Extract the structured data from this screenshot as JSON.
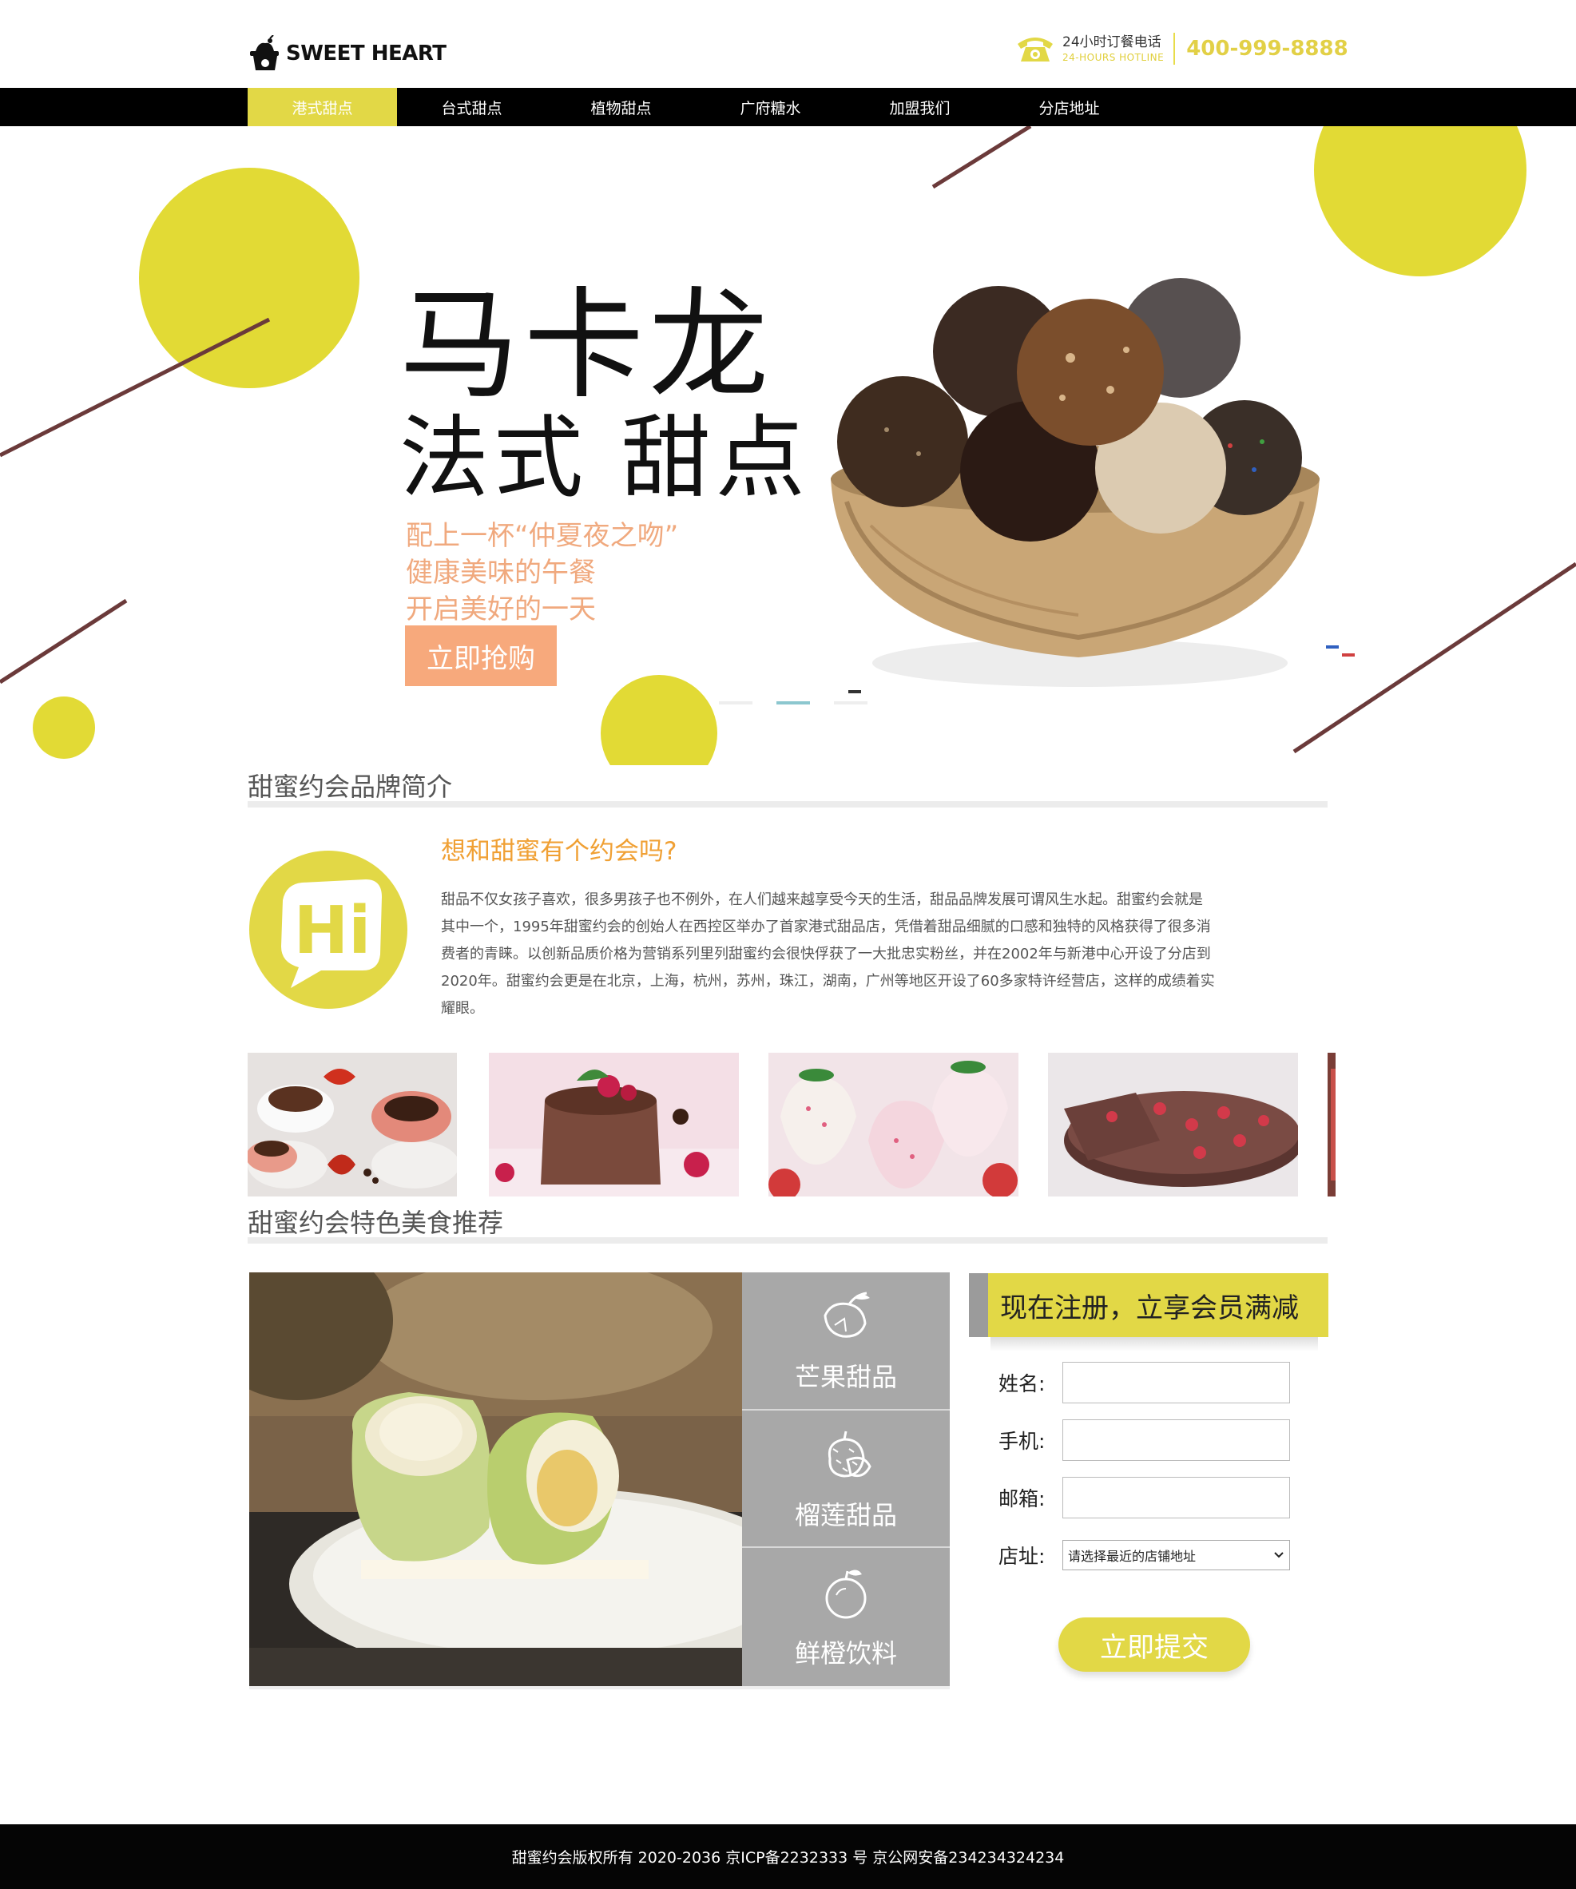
{
  "header": {
    "logo_text": "SWEET HEART",
    "hotline_cn": "24小时订餐电话",
    "hotline_en": "24-HOURS HOTLINE",
    "hotline_number": "400-999-8888"
  },
  "nav": {
    "items": [
      "港式甜点",
      "台式甜点",
      "植物甜点",
      "广府糖水",
      "加盟我们",
      "分店地址"
    ],
    "active_index": 0
  },
  "banner": {
    "title_line1": "马卡龙",
    "title_line2": "法式 甜点",
    "sub_line1": "配上一杯“仲夏夜之吻”",
    "sub_line2": "健康美味的午餐",
    "sub_line3": "开启美好的一天",
    "cta_label": "立即抢购",
    "slide_count": 3,
    "active_slide": 1
  },
  "brand": {
    "title": "甜蜜约会品牌简介",
    "heading": "想和甜蜜有个约会吗?",
    "body": "甜品不仅女孩子喜欢，很多男孩子也不例外，在人们越来越享受今天的生活，甜品品牌发展可谓风生水起。甜蜜约会就是其中一个，1995年甜蜜约会的创始人在西控区举办了首家港式甜品店，凭借着甜品细腻的口感和独特的风格获得了很多消费者的青睐。以创新品质价格为营销系列里列甜蜜约会很快俘获了一大批忠实粉丝，并在2002年与新港中心开设了分店到2020年。甜蜜约会更是在北京，上海，杭州，苏州，珠江，湖南，广州等地区开设了60多家特许经营店，这样的成绩着实耀眼。",
    "badge_text": "Hi"
  },
  "recommend": {
    "title": "甜蜜约会特色美食推荐",
    "categories": [
      "芒果甜品",
      "榴莲甜品",
      "鲜橙饮料"
    ]
  },
  "register": {
    "title": "现在注册，立享会员满减",
    "name_label": "姓名:",
    "phone_label": "手机:",
    "email_label": "邮箱:",
    "store_label": "店址:",
    "store_selected": "请选择最近的店铺地址",
    "submit_label": "立即提交"
  },
  "footer": {
    "text": "甜蜜约会版权所有 2020-2036 京ICP备2232333 号  京公网安备234234324234"
  },
  "colors": {
    "accent_yellow": "#e2d846",
    "accent_orange": "#f7a97c",
    "heading_orange": "#f0a034",
    "nav_bg": "#000000",
    "footer_bg": "#050505",
    "category_gray": "#a8a8a8"
  }
}
